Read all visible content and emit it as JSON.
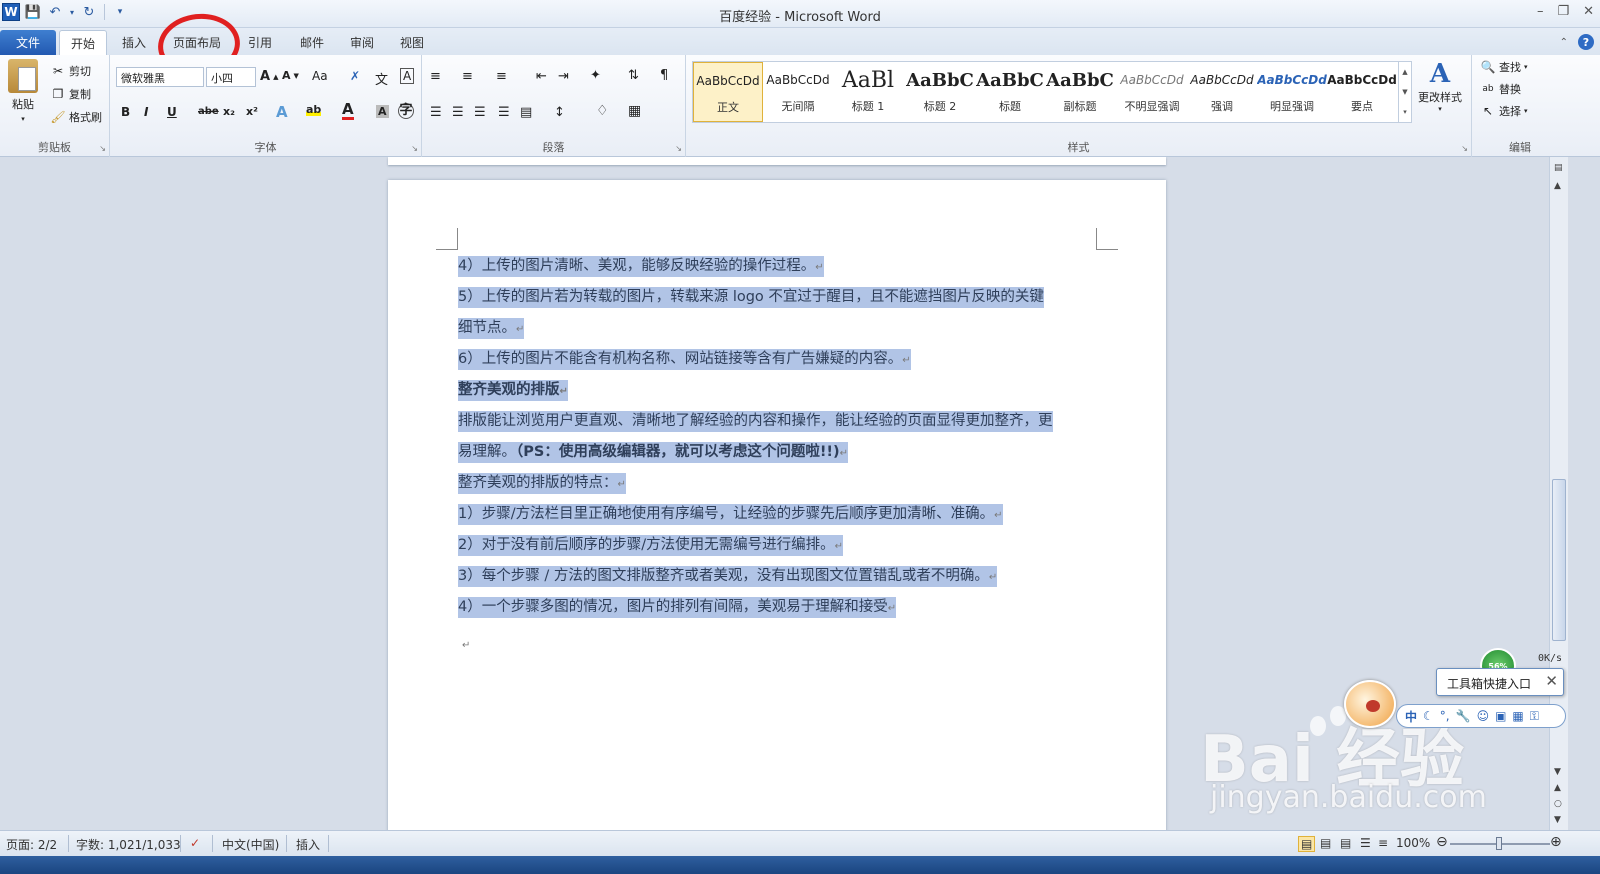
{
  "window": {
    "title": "百度经验 - Microsoft Word",
    "app_icon_letter": "W"
  },
  "tabs": [
    {
      "label": "文件"
    },
    {
      "label": "开始"
    },
    {
      "label": "插入"
    },
    {
      "label": "页面布局"
    },
    {
      "label": "引用"
    },
    {
      "label": "邮件"
    },
    {
      "label": "审阅"
    },
    {
      "label": "视图"
    }
  ],
  "ribbon": {
    "clipboard": {
      "label": "剪贴板",
      "paste": "粘贴",
      "cut": "剪切",
      "copy": "复制",
      "format_painter": "格式刷"
    },
    "font": {
      "label": "字体",
      "font_name": "微软雅黑",
      "font_size": "小四",
      "change_case": "Aa",
      "bold": "B",
      "italic": "I",
      "underline": "U",
      "strikethrough": "abe",
      "subscript": "x₂",
      "superscript": "x²"
    },
    "paragraph": {
      "label": "段落"
    },
    "styles": {
      "label": "样式",
      "change_styles": "更改样式",
      "items": [
        {
          "sample": "AaBbCcDd",
          "name": "正文",
          "font_size": 12
        },
        {
          "sample": "AaBbCcDd",
          "name": "无间隔",
          "font_size": 12
        },
        {
          "sample": "AaBl",
          "name": "标题 1",
          "font_size": 22
        },
        {
          "sample": "AaBbC",
          "name": "标题 2",
          "font_size": 18
        },
        {
          "sample": "AaBbC",
          "name": "标题",
          "font_size": 18
        },
        {
          "sample": "AaBbC",
          "name": "副标题",
          "font_size": 18
        },
        {
          "sample": "AaBbCcDd",
          "name": "不明显强调",
          "font_size": 12
        },
        {
          "sample": "AaBbCcDd",
          "name": "强调",
          "font_size": 12
        },
        {
          "sample": "AaBbCcDd",
          "name": "明显强调",
          "font_size": 12
        },
        {
          "sample": "AaBbCcDd",
          "name": "要点",
          "font_size": 12
        }
      ]
    },
    "editing": {
      "label": "编辑",
      "find": "查找",
      "replace": "替换",
      "select": "选择"
    }
  },
  "document": {
    "lines": [
      {
        "text": "4）上传的图片清晰、美观，能够反映经验的操作过程。",
        "bold": false
      },
      {
        "text": "5）上传的图片若为转载的图片，转载来源 logo 不宜过于醒目，且不能遮挡图片反映的关键",
        "bold": false
      },
      {
        "text": "细节点。",
        "bold": false
      },
      {
        "text": "6）上传的图片不能含有机构名称、网站链接等含有广告嫌疑的内容。",
        "bold": false
      },
      {
        "text": "整齐美观的排版",
        "bold": true
      },
      {
        "text": "排版能让浏览用户更直观、清晰地了解经验的内容和操作，能让经验的页面显得更加整齐，更",
        "bold": false
      },
      {
        "text": "易理解。",
        "bold": false,
        "bold_tail": "（PS：使用高级编辑器，就可以考虑这个问题啦!!)"
      },
      {
        "text": "整齐美观的排版的特点：",
        "bold": false
      },
      {
        "text": "1）步骤/方法栏目里正确地使用有序编号，让经验的步骤先后顺序更加清晰、准确。",
        "bold": false
      },
      {
        "text": "2）对于没有前后顺序的步骤/方法使用无需编号进行编排。",
        "bold": false
      },
      {
        "text": "3）每个步骤 / 方法的图文排版整齐或者美观，没有出现图文位置错乱或者不明确。",
        "bold": false
      },
      {
        "text": "4）一个步骤多图的情况，图片的排列有间隔，美观易于理解和接受",
        "bold": false
      }
    ],
    "paragraph_mark": "↵"
  },
  "statusbar": {
    "page": "页面: 2/2",
    "words": "字数: 1,021/1,033",
    "language": "中文(中国)",
    "mode": "插入",
    "zoom": "100%"
  },
  "widgets": {
    "net_badge": "56%",
    "net_speed": "0K/s",
    "toolbox_tip": "工具箱快捷入口",
    "ime_label": "中"
  },
  "watermark": {
    "main": "Bai 经验",
    "sub": "jingyan.baidu.com"
  },
  "colors": {
    "selection": "#b1c4e6",
    "file_tab": "#2a63b8",
    "annotation_circle": "#e02020"
  }
}
